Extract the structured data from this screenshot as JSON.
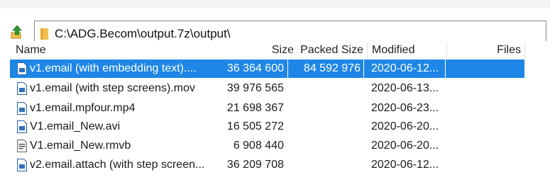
{
  "toolbar": {
    "up_icon": "folder-up-arrow-icon",
    "path": "C:\\ADG.Becom\\output.7z\\output\\",
    "folder_icon": "folder-icon"
  },
  "columns": {
    "name": "Name",
    "size": "Size",
    "packed": "Packed Size",
    "modified": "Modified",
    "files": "Files"
  },
  "rows": [
    {
      "name": "v1.email (with embedding text)....",
      "size": "36 364 600",
      "packed": "84 592 976",
      "modified": "2020-06-12...",
      "files": "",
      "icon": "video-file-icon",
      "selected": true
    },
    {
      "name": "v1.email (with step screens).mov",
      "size": "39 976 565",
      "packed": "",
      "modified": "2020-06-13...",
      "files": "",
      "icon": "video-file-icon",
      "selected": false
    },
    {
      "name": "v1.email.mpfour.mp4",
      "size": "21 698 367",
      "packed": "",
      "modified": "2020-06-23...",
      "files": "",
      "icon": "video-file-icon",
      "selected": false
    },
    {
      "name": "V1.email_New.avi",
      "size": "16 505 272",
      "packed": "",
      "modified": "2020-06-20...",
      "files": "",
      "icon": "video-file-icon",
      "selected": false
    },
    {
      "name": "V1.email_New.rmvb",
      "size": "6 908 440",
      "packed": "",
      "modified": "2020-06-20...",
      "files": "",
      "icon": "generic-file-icon",
      "selected": false
    },
    {
      "name": "v2.email.attach (with step screen...",
      "size": "36 209 708",
      "packed": "",
      "modified": "2020-06-12...",
      "files": "",
      "icon": "video-file-icon",
      "selected": false
    }
  ],
  "colors": {
    "selection": "#1e86e6",
    "up_arrow": "#2f9a2f",
    "folder": "#f2c14e"
  }
}
